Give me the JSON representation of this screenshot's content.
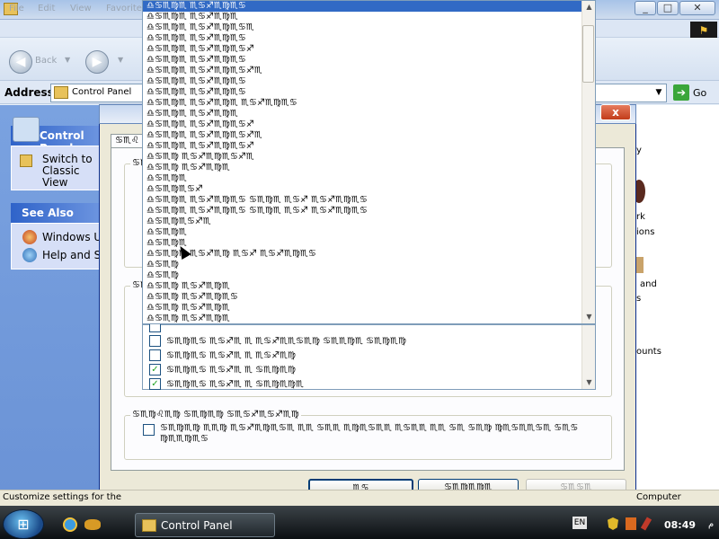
{
  "window": {
    "title": "",
    "controls": {
      "minimize": "_",
      "maximize": "□",
      "close": "✕"
    },
    "brand_logo": "⚑"
  },
  "menubar": {
    "items": [
      "File",
      "Edit",
      "View",
      "Favorites"
    ]
  },
  "toolbar": {
    "back_label": "Back",
    "back_symbol": "◀",
    "forward_symbol": "▶"
  },
  "address": {
    "label": "Address",
    "value": "Control Panel",
    "dropdown_symbol": "▼",
    "go_symbol": "➔",
    "go_label": "Go"
  },
  "left_panel": {
    "control_panel": {
      "title": "Control Panel",
      "switch_link": "Switch to Classic View"
    },
    "see_also": {
      "title": "See Also",
      "items": [
        "Windows Update",
        "Help and Support"
      ]
    }
  },
  "right_panel": {
    "texts": [
      "y",
      "rk",
      "ions",
      "and",
      "s",
      "ounts",
      "Computer"
    ]
  },
  "dialog": {
    "close_symbol": "x",
    "tab_label": "♋♏♌",
    "group1_title": "♋♏♌♍♏♍♋♐♊♏",
    "group2_title": "♋♏♍♏♋♐",
    "group3_title": "♋♏♍♌♏♍ ♋♏♍♏♍ ♋♏♋♐♏♋♐♏♍",
    "group3_option": "♋♏♍♏♍ ♏♏♍ ♏♋♐♏♍♏♋♏ ♏♏ ♋♏♏ ♏♍♏♋♏♏ ♏♋♏♏ ♏♏ ♋♏ ♋♏♍ ♍♏♋♏♏♋♏ ♋♏♋ ♍♏♏♍♏♋",
    "list_rows": [
      {
        "text": "♋♏♍♏♋ ♏♋♐♏ ♏ ♏♋♐♏♏♋♏♍ ♋♏♏♍♏ ♋♏♍♏♍",
        "checked": false
      },
      {
        "text": "♋♏♍♏♋ ♏♋♐♏ ♏ ♏♋♐♏♍",
        "checked": false
      },
      {
        "text": "♋♏♍♏♋ ♏♋♐♏ ♏ ♋♏♍♏♍",
        "checked": true
      },
      {
        "text": "♋♏♍♏♋ ♏♋♐♏ ♏ ♋♏♍♏♍♏",
        "checked": true
      }
    ],
    "buttons": {
      "ok": "♏♋",
      "cancel": "♋♏♍♏♍♏",
      "apply": "♋♏♋♏"
    }
  },
  "dropdown": {
    "items": [
      {
        "text": "♎♋♏♍♏ ♏♋♐♏♍♏♋",
        "selected": true
      },
      {
        "text": "♎♋♏♍♏ ♏♋♐♏♍♏",
        "selected": false
      },
      {
        "text": "♎♋♏♍♏ ♏♋♐♏♍♏♋♏",
        "selected": false
      },
      {
        "text": "♎♋♏♍♏ ♏♋♐♏♍♏♋",
        "selected": false
      },
      {
        "text": "♎♋♏♍♏ ♏♋♐♏♍♏♋♐",
        "selected": false
      },
      {
        "text": "♎♋♏♍♏ ♏♋♐♏♍♏♋",
        "selected": false
      },
      {
        "text": "♎♋♏♍♏ ♏♋♐♏♍♏♋♐♏",
        "selected": false
      },
      {
        "text": "♎♋♏♍♏ ♏♋♐♏♍♏♋",
        "selected": false
      },
      {
        "text": "♎♋♏♍♏ ♏♋♐♏♍♏♋",
        "selected": false
      },
      {
        "text": "♎♋♏♍♏ ♏♋♐♏♍♏ ♏♋♐♏♍♏♋",
        "selected": false
      },
      {
        "text": "♎♋♏♍♏ ♏♋♐♏♍♏",
        "selected": false
      },
      {
        "text": "♎♋♏♍♏ ♏♋♐♏♍♏♋♐",
        "selected": false
      },
      {
        "text": "♎♋♏♍♏ ♏♋♐♏♍♏♋♐♏",
        "selected": false
      },
      {
        "text": "♎♋♏♍♏ ♏♋♐♏♍♏♋♐",
        "selected": false
      },
      {
        "text": "♎♋♏♍ ♏♋♐♏♍♏♋♐♏",
        "selected": false
      },
      {
        "text": "♎♋♏♍ ♏♋♐♏♍♏",
        "selected": false
      },
      {
        "text": "♎♋♏♍♏",
        "selected": false
      },
      {
        "text": "♎♋♏♍♏♋♐",
        "selected": false
      },
      {
        "text": "♎♋♏♍♏ ♏♋♐♏♍♏♋ ♋♏♍♏ ♏♋♐ ♏♋♐♏♍♏♋",
        "selected": false
      },
      {
        "text": "♎♋♏♍♏ ♏♋♐♏♍♏♋ ♋♏♍♏ ♏♋♐ ♏♋♐♏♍♏♋",
        "selected": false
      },
      {
        "text": "♎♋♏♍♏♋♐♏",
        "selected": false
      },
      {
        "text": "♎♋♏♍♏",
        "selected": false
      },
      {
        "text": "♎♋♏♍♏",
        "selected": false
      },
      {
        "text": "♎♋♏♍♏ ♏♋♐♏♍ ♏♋♐ ♏♋♐♏♍♏♋",
        "selected": false
      },
      {
        "text": "♎♋♏♍",
        "selected": false
      },
      {
        "text": "♎♋♏♍",
        "selected": false
      },
      {
        "text": "♎♋♏♍ ♏♋♐♏♍♏",
        "selected": false
      },
      {
        "text": "♎♋♏♍ ♏♋♐♏♍♏♋",
        "selected": false
      },
      {
        "text": "♎♋♏♍ ♏♋♐♏♍♏",
        "selected": false
      },
      {
        "text": "♎♋♏♍ ♏♋♐♏♍♏",
        "selected": false
      }
    ],
    "scroll_up": "▲",
    "scroll_down": "▼"
  },
  "statusbar": {
    "left": "Customize settings for the",
    "right": "Computer"
  },
  "taskbar": {
    "start_symbol": "⊞",
    "active_task": "Control Panel",
    "language": "EN",
    "clock": "08:49",
    "ampm": "م"
  }
}
